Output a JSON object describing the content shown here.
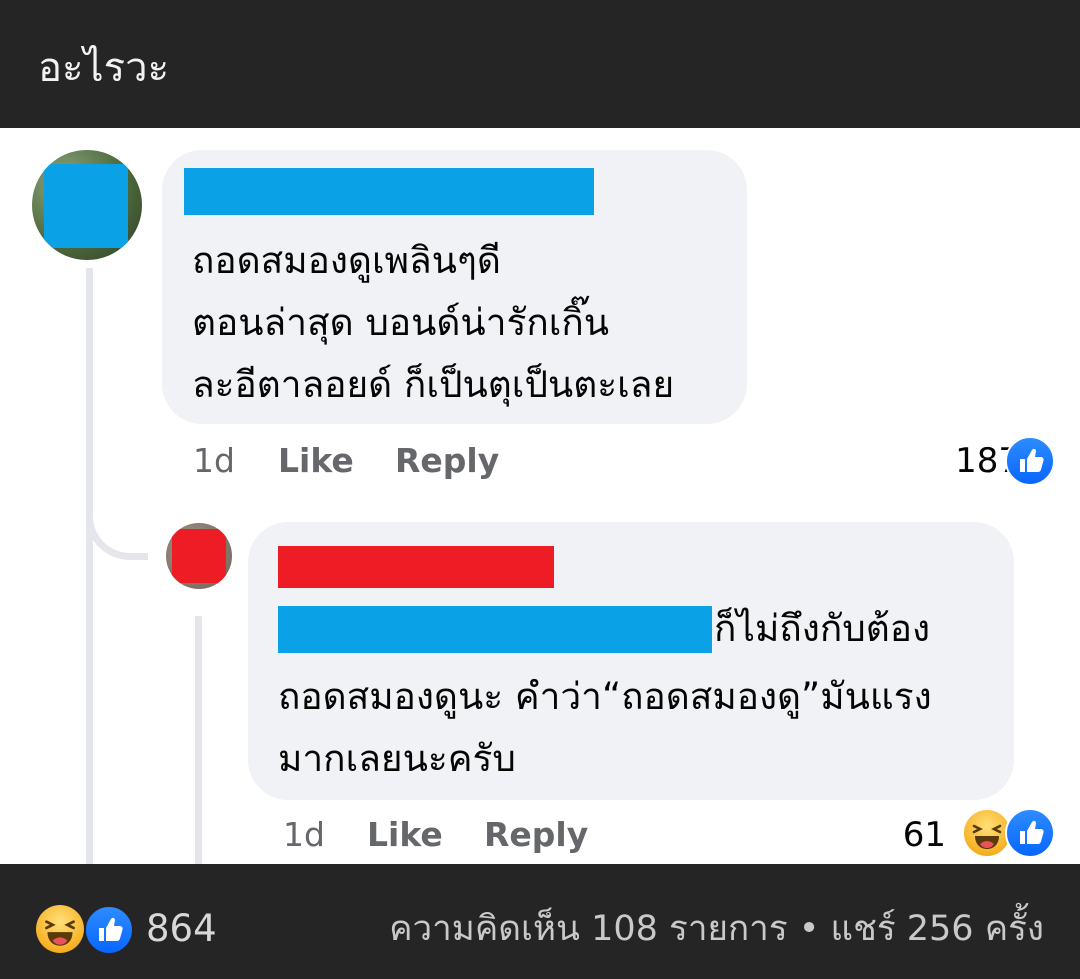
{
  "header": {
    "title": "อะไรวะ"
  },
  "comment": {
    "lines": [
      "ถอดสมองดูเพลินๆดี",
      "ตอนล่าสุด บอนด์น่ารักเกิ๊น",
      "ละอีตาลอยด์ ก็เป็นตุเป็นตะเลย"
    ],
    "time": "1d",
    "like_label": "Like",
    "reply_label": "Reply",
    "reaction_count": "187",
    "reactions": [
      "like-icon"
    ]
  },
  "reply": {
    "lines": [
      "ก็ไม่ถึงกับต้อง",
      "ถอดสมองดูนะ คำว่า“ถอดสมองดู”มันแรง",
      "มากเลยนะครับ"
    ],
    "time": "1d",
    "like_label": "Like",
    "reply_label": "Reply",
    "reaction_count": "61",
    "reactions": [
      "haha-icon",
      "like-icon"
    ]
  },
  "footer": {
    "total_reactions": "864",
    "stats": "ความคิดเห็น 108 รายการ • แชร์ 256 ครั้ง",
    "reactions": [
      "haha-icon",
      "like-icon"
    ]
  },
  "colors": {
    "dark_bar": "#252526",
    "bubble": "#f0f2f5",
    "redact_blue": "#0ba1e6",
    "redact_red": "#ee1c25",
    "like_blue": "#0866ff",
    "haha_yellow": "#f7b125"
  }
}
